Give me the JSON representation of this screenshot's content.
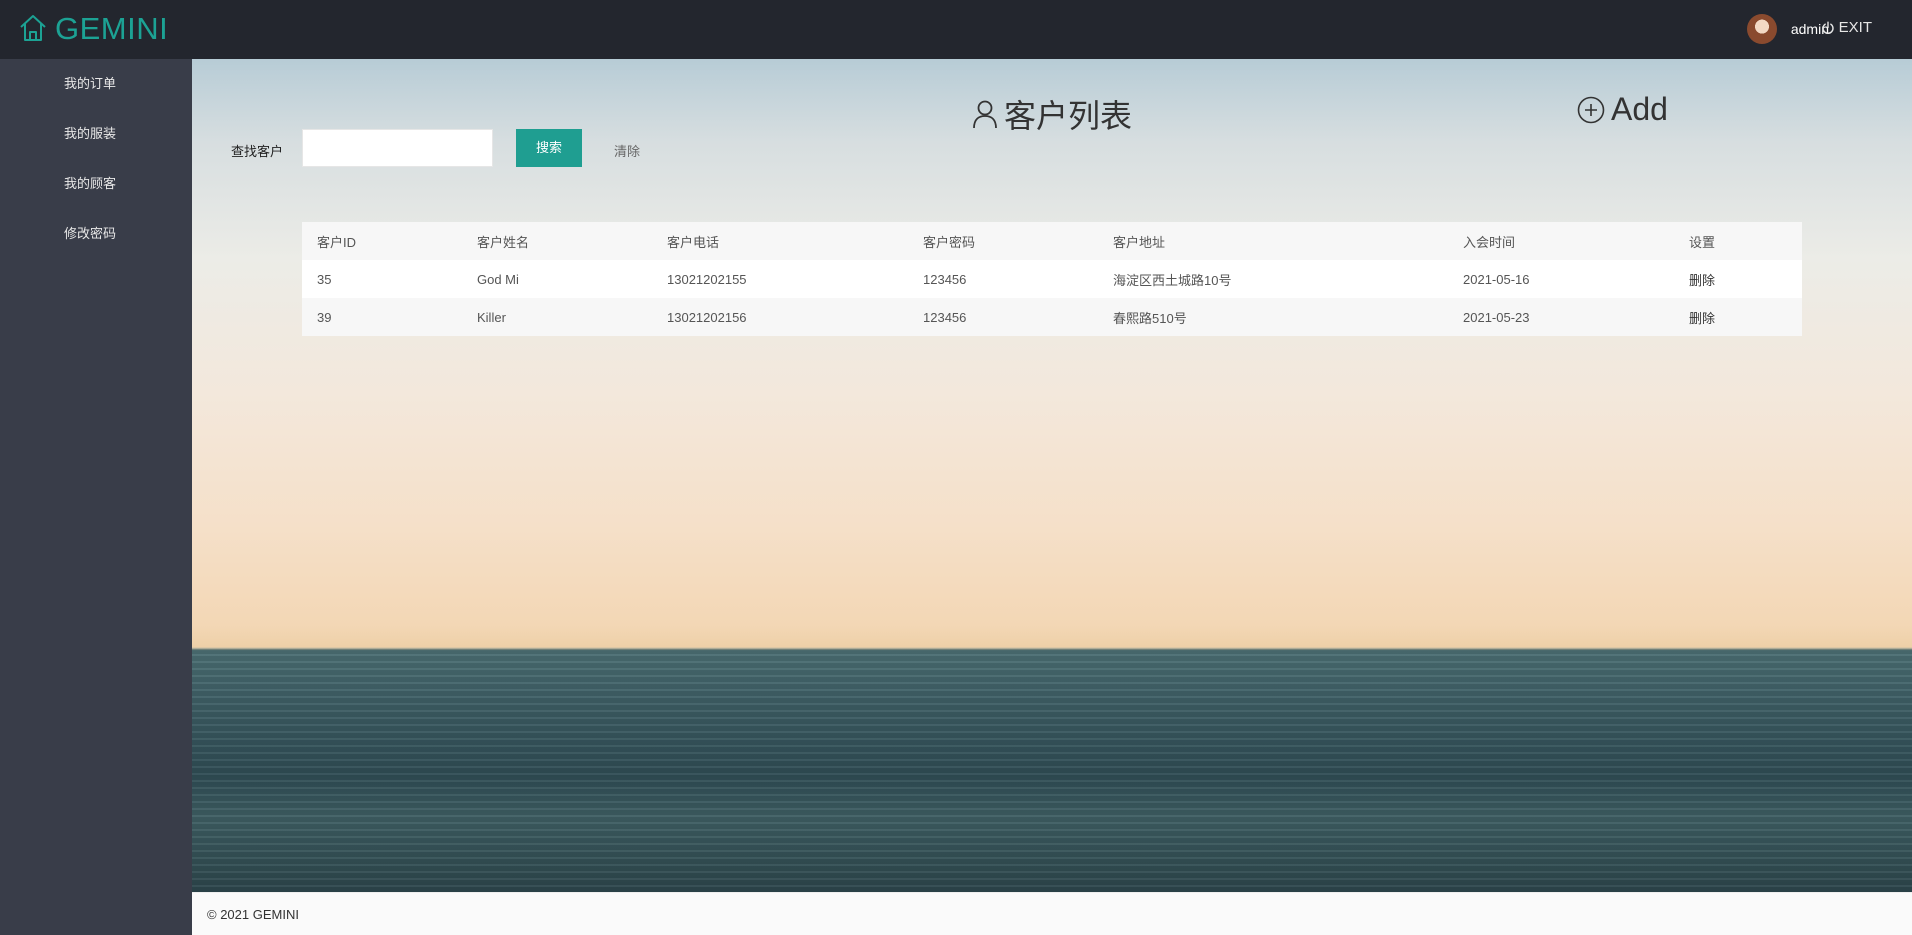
{
  "header": {
    "logo": "GEMINI",
    "username": "admin",
    "exit_label": "EXIT"
  },
  "sidebar": {
    "items": [
      {
        "label": "我的订单"
      },
      {
        "label": "我的服装"
      },
      {
        "label": "我的顾客"
      },
      {
        "label": "修改密码"
      }
    ]
  },
  "main": {
    "search_label": "查找客户",
    "search_value": "",
    "search_button": "搜索",
    "clear_button": "清除",
    "title": "客户列表",
    "add_label": "Add",
    "table": {
      "columns": [
        "客户ID",
        "客户姓名",
        "客户电话",
        "客户密码",
        "客户地址",
        "入会时间",
        "设置"
      ],
      "rows": [
        {
          "id": "35",
          "name": "God Mi",
          "phone": "13021202155",
          "password": "123456",
          "address": "海淀区西土城路10号",
          "joined": "2021-05-16",
          "action": "删除"
        },
        {
          "id": "39",
          "name": "Killer",
          "phone": "13021202156",
          "password": "123456",
          "address": "春熙路510号",
          "joined": "2021-05-23",
          "action": "删除"
        }
      ]
    }
  },
  "footer": {
    "text": "© 2021 GEMINI"
  },
  "colors": {
    "header_bg": "#23262e",
    "sidebar_bg": "#393d49",
    "accent": "#1f9e91",
    "logo": "#1ca294"
  }
}
